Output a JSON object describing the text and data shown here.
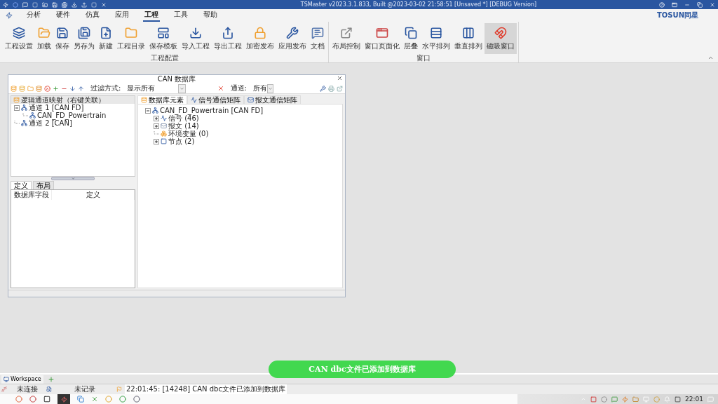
{
  "title_bar": {
    "title": "TSMaster v2023.3.1.833, Built @2023-03-02 21:58:51 [Unsaved *] [DEBUG Version]"
  },
  "menu": [
    {
      "label": "分析",
      "selected": false
    },
    {
      "label": "硬件",
      "selected": false
    },
    {
      "label": "仿真",
      "selected": false
    },
    {
      "label": "应用",
      "selected": false
    },
    {
      "label": "工程",
      "selected": true
    },
    {
      "label": "工具",
      "selected": false
    },
    {
      "label": "帮助",
      "selected": false
    }
  ],
  "brand": "TOSUN同星",
  "ribbon": [
    {
      "label": "工程配置",
      "buttons": [
        {
          "label": "工程设置",
          "selected": false
        },
        {
          "label": "加载",
          "selected": false
        },
        {
          "label": "保存",
          "selected": false
        },
        {
          "label": "另存为",
          "selected": false
        },
        {
          "label": "新建",
          "selected": false
        },
        {
          "label": "工程目录",
          "selected": false
        },
        {
          "label": "保存模板",
          "selected": false
        },
        {
          "label": "导入工程",
          "selected": false
        },
        {
          "label": "导出工程",
          "selected": false
        },
        {
          "label": "加密发布",
          "selected": false
        },
        {
          "label": "应用发布",
          "selected": false
        },
        {
          "label": "文档",
          "selected": false
        }
      ]
    },
    {
      "label": "窗口",
      "buttons": [
        {
          "label": "布局控制",
          "selected": false
        },
        {
          "label": "窗口页面化",
          "selected": false
        },
        {
          "label": "层叠",
          "selected": false
        },
        {
          "label": "水平排列",
          "selected": false
        },
        {
          "label": "垂直排列",
          "selected": false
        },
        {
          "label": "磁吸窗口",
          "selected": true
        }
      ]
    }
  ],
  "db_window": {
    "title": "CAN 数据库",
    "filter_label": "过滤方式:",
    "filter_value": "显示所有",
    "channel_label": "通道:",
    "channel_value": "所有",
    "left_header": "逻辑通道映射（右键关联）",
    "channel_tree": [
      {
        "label": "通道 1 [CAN FD]",
        "kind": "group",
        "expanded": true,
        "children": [
          {
            "label": "CAN_FD_Powertrain",
            "kind": "leaf"
          }
        ]
      },
      {
        "label": "通道 2 [CAN]",
        "kind": "leaf"
      }
    ],
    "bottom_tabs": [
      {
        "label": "定义",
        "selected": true
      },
      {
        "label": "布局",
        "selected": false
      }
    ],
    "columns": [
      "数据库字段",
      "定义"
    ],
    "tabs": [
      {
        "label": "数据库元素",
        "selected": true
      },
      {
        "label": "信号通信矩阵",
        "selected": false
      },
      {
        "label": "报文通信矩阵",
        "selected": false
      }
    ],
    "element_tree": [
      {
        "label": "CAN_FD_Powertrain [CAN FD]",
        "kind": "group",
        "expanded": true,
        "children": [
          {
            "label": "信号 (46)",
            "kind": "group",
            "expanded": false
          },
          {
            "label": "报文 (14)",
            "kind": "group",
            "expanded": false
          },
          {
            "label": "环境变量 (0)",
            "kind": "leaf"
          },
          {
            "label": "节点 (2)",
            "kind": "group",
            "expanded": false
          }
        ]
      }
    ]
  },
  "toast": "CAN dbc文件已添加到数据库",
  "workspace_tab": "Workspace",
  "status_bar": {
    "connection": "未连接",
    "recording": "未记录",
    "message": "22:01:45: [14248] CAN dbc文件已添加到数据库"
  },
  "taskbar": {
    "clock": "22:01"
  }
}
